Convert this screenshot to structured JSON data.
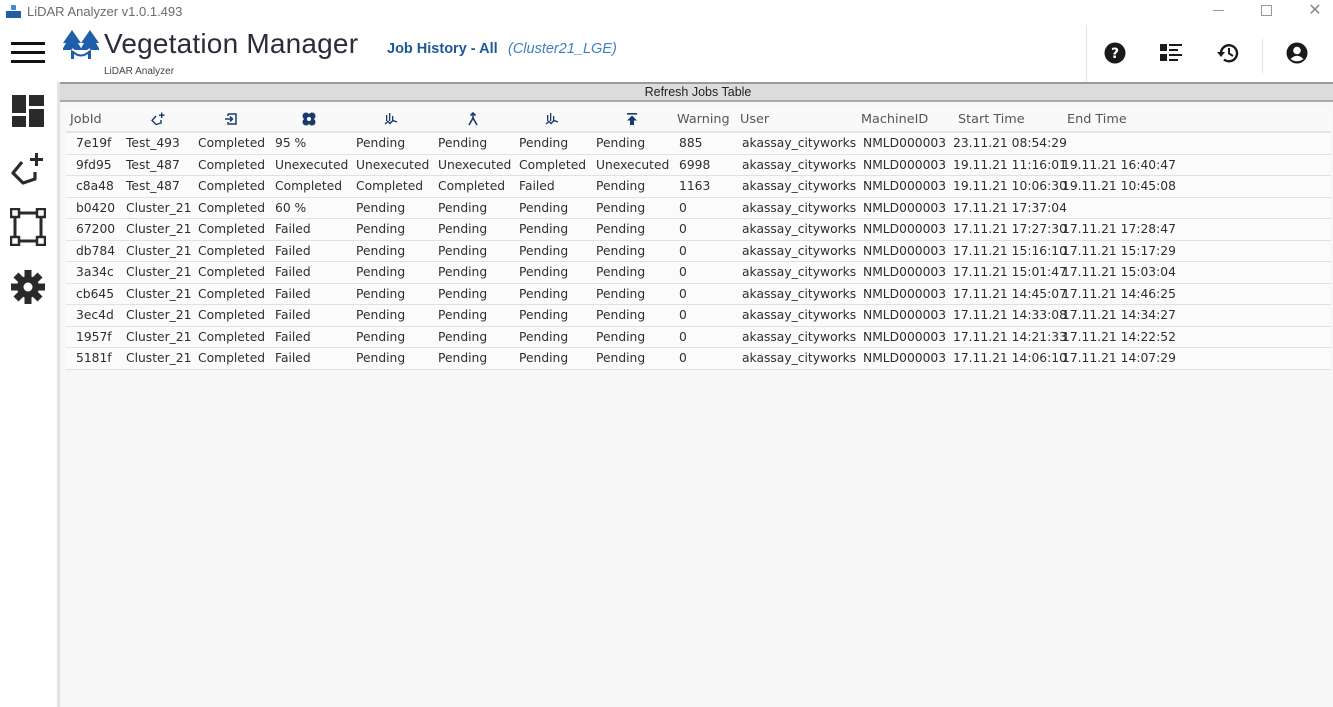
{
  "window": {
    "title": "LiDAR Analyzer v1.0.1.493",
    "controls": [
      "minimize",
      "maximize",
      "close"
    ]
  },
  "header": {
    "brand": "Vegetation Manager",
    "brand_sub": "LiDAR Analyzer",
    "page_title": "Job History - All",
    "page_subtitle": "(Cluster21_LGE)",
    "toolbar": [
      {
        "name": "help",
        "icon": "question-circle-icon"
      },
      {
        "name": "job-list",
        "icon": "list-view-icon"
      },
      {
        "name": "history",
        "icon": "history-icon"
      },
      {
        "name": "account",
        "icon": "account-circle-icon"
      }
    ]
  },
  "sidebar": {
    "items": [
      {
        "name": "dashboard",
        "icon": "dashboard-icon"
      },
      {
        "name": "add-polygon",
        "icon": "polygon-add-icon"
      },
      {
        "name": "bounding-box",
        "icon": "bounding-box-icon"
      },
      {
        "name": "settings",
        "icon": "gear-icon"
      }
    ]
  },
  "main": {
    "refresh_label": "Refresh Jobs Table",
    "table": {
      "columns": [
        {
          "key": "jobid",
          "label": "JobId"
        },
        {
          "key": "polygon",
          "label": "",
          "icon": "polygon-add-icon"
        },
        {
          "key": "import",
          "label": "",
          "icon": "import-icon"
        },
        {
          "key": "process",
          "label": "",
          "icon": "process-icon"
        },
        {
          "key": "analysis1",
          "label": "",
          "icon": "vegetation-analysis-icon"
        },
        {
          "key": "merge",
          "label": "",
          "icon": "merge-icon"
        },
        {
          "key": "analysis2",
          "label": "",
          "icon": "vegetation-analysis-icon"
        },
        {
          "key": "upload",
          "label": "",
          "icon": "upload-icon"
        },
        {
          "key": "warning",
          "label": "Warning"
        },
        {
          "key": "user",
          "label": "User"
        },
        {
          "key": "machine",
          "label": "MachineID"
        },
        {
          "key": "start",
          "label": "Start Time"
        },
        {
          "key": "end",
          "label": "End Time"
        }
      ],
      "rows": [
        [
          "7e19f",
          "Test_493",
          "Completed",
          "95 %",
          "Pending",
          "Pending",
          "Pending",
          "Pending",
          "885",
          "akassay_cityworks",
          "NMLD000003",
          "23.11.21 08:54:29",
          ""
        ],
        [
          "9fd95",
          "Test_487",
          "Completed",
          "Unexecuted",
          "Unexecuted",
          "Unexecuted",
          "Completed",
          "Unexecuted",
          "6998",
          "akassay_cityworks",
          "NMLD000003",
          "19.11.21 11:16:01",
          "19.11.21 16:40:47"
        ],
        [
          "c8a48",
          "Test_487",
          "Completed",
          "Completed",
          "Completed",
          "Completed",
          "Failed",
          "Pending",
          "1163",
          "akassay_cityworks",
          "NMLD000003",
          "19.11.21 10:06:30",
          "19.11.21 10:45:08"
        ],
        [
          "b0420",
          "Cluster_21",
          "Completed",
          "60 %",
          "Pending",
          "Pending",
          "Pending",
          "Pending",
          "0",
          "akassay_cityworks",
          "NMLD000003",
          "17.11.21 17:37:04",
          ""
        ],
        [
          "67200",
          "Cluster_21",
          "Completed",
          "Failed",
          "Pending",
          "Pending",
          "Pending",
          "Pending",
          "0",
          "akassay_cityworks",
          "NMLD000003",
          "17.11.21 17:27:30",
          "17.11.21 17:28:47"
        ],
        [
          "db784",
          "Cluster_21",
          "Completed",
          "Failed",
          "Pending",
          "Pending",
          "Pending",
          "Pending",
          "0",
          "akassay_cityworks",
          "NMLD000003",
          "17.11.21 15:16:10",
          "17.11.21 15:17:29"
        ],
        [
          "3a34c",
          "Cluster_21",
          "Completed",
          "Failed",
          "Pending",
          "Pending",
          "Pending",
          "Pending",
          "0",
          "akassay_cityworks",
          "NMLD000003",
          "17.11.21 15:01:47",
          "17.11.21 15:03:04"
        ],
        [
          "cb645",
          "Cluster_21",
          "Completed",
          "Failed",
          "Pending",
          "Pending",
          "Pending",
          "Pending",
          "0",
          "akassay_cityworks",
          "NMLD000003",
          "17.11.21 14:45:07",
          "17.11.21 14:46:25"
        ],
        [
          "3ec4d",
          "Cluster_21",
          "Completed",
          "Failed",
          "Pending",
          "Pending",
          "Pending",
          "Pending",
          "0",
          "akassay_cityworks",
          "NMLD000003",
          "17.11.21 14:33:08",
          "17.11.21 14:34:27"
        ],
        [
          "1957f",
          "Cluster_21",
          "Completed",
          "Failed",
          "Pending",
          "Pending",
          "Pending",
          "Pending",
          "0",
          "akassay_cityworks",
          "NMLD000003",
          "17.11.21 14:21:33",
          "17.11.21 14:22:52"
        ],
        [
          "5181f",
          "Cluster_21",
          "Completed",
          "Failed",
          "Pending",
          "Pending",
          "Pending",
          "Pending",
          "0",
          "akassay_cityworks",
          "NMLD000003",
          "17.11.21 14:06:10",
          "17.11.21 14:07:29"
        ]
      ]
    }
  },
  "colors": {
    "brand_text": "#2b2b3a",
    "page_title": "#1d5996",
    "page_subtitle": "#3f7fc4",
    "header_icon": "#1a3a6b",
    "refresh_bar": "#dcdcdc"
  }
}
